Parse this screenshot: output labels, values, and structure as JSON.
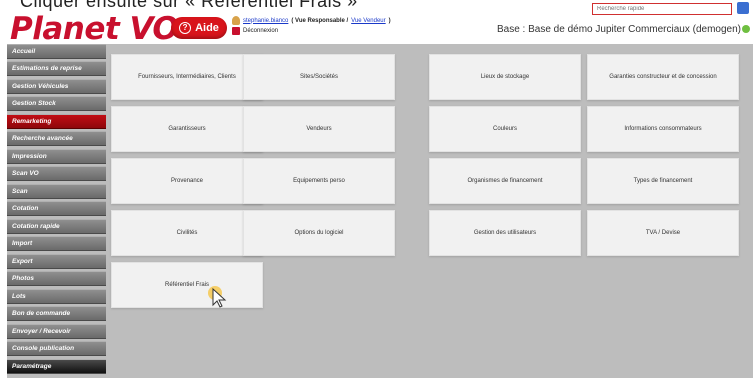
{
  "caption": "Cliquer ensuite sur « Referentiel Frais »",
  "header": {
    "logo": "Planet VO",
    "help_label": "Aide",
    "user_name": "stephanie.bianco",
    "user_role_prefix": "( Vue Responsable / ",
    "user_role_link": "Vue Vendeur",
    "user_role_suffix": " )",
    "logout_label": "Déconnexion",
    "search_placeholder": "Recherche rapide",
    "base_label": "Base : Base de démo Jupiter Commerciaux (demogen)"
  },
  "sidebar": {
    "items": [
      {
        "label": "Accueil"
      },
      {
        "label": "Estimations de reprise"
      },
      {
        "label": "Gestion Véhicules"
      },
      {
        "label": "Gestion Stock"
      },
      {
        "label": "Remarketing"
      },
      {
        "label": "Recherche avancée"
      },
      {
        "label": "Impression"
      },
      {
        "label": "Scan VO"
      },
      {
        "label": "Scan"
      },
      {
        "label": "Cotation"
      },
      {
        "label": "Cotation rapide"
      },
      {
        "label": "Import"
      },
      {
        "label": "Export"
      },
      {
        "label": "Photos"
      },
      {
        "label": "Lots"
      },
      {
        "label": "Bon de commande"
      },
      {
        "label": "Envoyer / Recevoir"
      },
      {
        "label": "Console publication"
      },
      {
        "label": "Paramétrage"
      }
    ],
    "active_index": 4
  },
  "tiles": [
    {
      "label": "Fournisseurs, Intermédiaires, Clients"
    },
    {
      "label": "Sites/Sociétés"
    },
    {
      "label": "Lieux de stockage"
    },
    {
      "label": "Garanties constructeur et de concession"
    },
    {
      "label": "Garantisseurs"
    },
    {
      "label": "Vendeurs"
    },
    {
      "label": "Couleurs"
    },
    {
      "label": "Informations consommateurs"
    },
    {
      "label": "Provenance"
    },
    {
      "label": "Equipements perso"
    },
    {
      "label": "Organismes de financement"
    },
    {
      "label": "Types de financement"
    },
    {
      "label": "Civilités"
    },
    {
      "label": "Options du logiciel"
    },
    {
      "label": "Gestion des utilisateurs"
    },
    {
      "label": "TVA / Devise"
    },
    {
      "label": "Référentiel Frais"
    }
  ],
  "colors": {
    "brand_red": "#c8102e",
    "sidebar_grey": "#7a7a7a",
    "content_bg": "#bdbdbd",
    "tile_bg": "#f1f1f1",
    "link_blue": "#1a39c9"
  }
}
